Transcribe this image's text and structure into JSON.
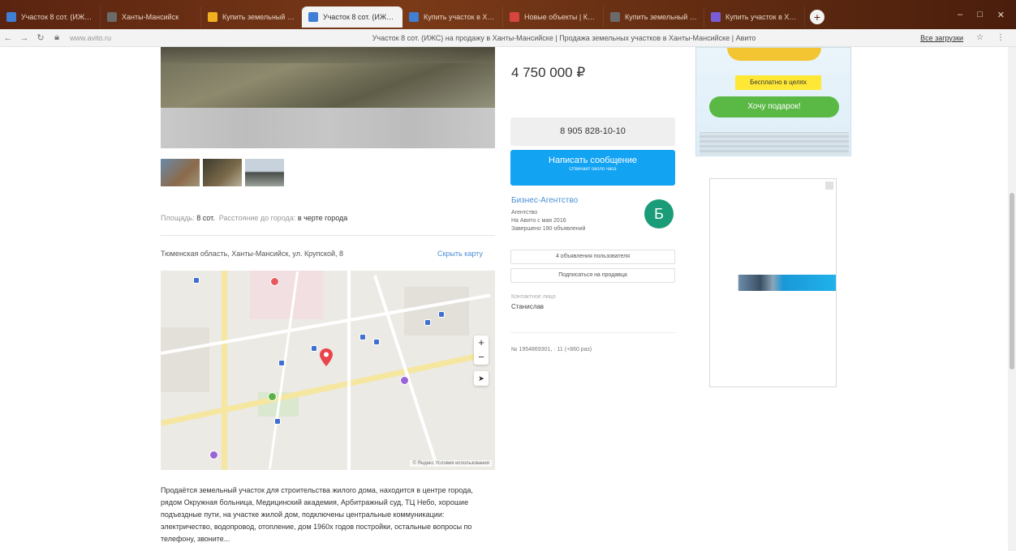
{
  "browser": {
    "tabs": [
      {
        "label": "Участок 8 сот. (ИЖС) по...",
        "icon": "avito-icon",
        "color": "#3f7fd6"
      },
      {
        "label": "Ханты-Мансийск",
        "icon": "page-icon",
        "color": "#6b6b6b"
      },
      {
        "label": "Купить земельный участок",
        "icon": "search-icon",
        "color": "#f2b01e"
      },
      {
        "label": "Участок 8 сот. (ИЖС) — Х",
        "icon": "avito-icon",
        "color": "#3f7fd6",
        "active": true
      },
      {
        "label": "Купить участок в Ханты",
        "icon": "avito-icon",
        "color": "#3f7fd6"
      },
      {
        "label": "Новые объекты | Купить",
        "icon": "yandex-icon",
        "color": "#d6463f"
      },
      {
        "label": "Купить земельный участ",
        "icon": "page-icon",
        "color": "#6b6b6b"
      },
      {
        "label": "Купить участок в Ханты",
        "icon": "page-icon",
        "color": "#7a5cd6"
      }
    ],
    "url_short": "www.avito.ru",
    "page_title": "Участок 8 сот. (ИЖС) на продажу в Ханты-Мансийске | Продажа земельных участков в Ханты-Мансийске | Авито",
    "download_label": "Все загрузки"
  },
  "listing": {
    "area_label": "Площадь:",
    "area_value": "8 сот.",
    "distance_label": "Расстояние до города:",
    "distance_value": "в черте города",
    "address": "Тюменская область, Ханты-Мансийск, ул. Крупской, 8",
    "map_link": "Скрыть карту",
    "map_attribution": "© Яндекс Условия использования",
    "description": "Продаётся земельный участок для строительства жилого дома, находится в центре города, рядом Окружная больница, Медицинский академия, Арбитражный суд, ТЦ Небо, хорошие подъездные пути, на участке жилой дом, подключены центральные коммуникации: электричество, водопровод, отопление, дом 1960х годов постройки, остальные вопросы по телефону, звоните..."
  },
  "sidebar": {
    "price": "4 750 000 ₽",
    "phone": "8 905 828-10-10",
    "message_label": "Написать сообщение",
    "message_sub": "Отвечает около часа",
    "seller_name": "Бизнес-Агентство",
    "seller_type": "Агентство",
    "seller_since": "На Авито с мая 2016",
    "seller_count": "Завершено 190 объявлений",
    "seller_initial": "Б",
    "all_ads_label": "4 объявления пользователя",
    "subscribe_label": "Подписаться на продавца",
    "contact_label": "Контактное лицо",
    "contact_name": "Станислав",
    "ad_number": "№ 1954869301, · 11 (+860 раз)"
  },
  "ads": {
    "banner_tag": "Бесплатно в целях",
    "banner_button": "Хочу подарок!"
  },
  "colors": {
    "accent": "#13a3f3",
    "seller_avatar": "#1b9c78",
    "link": "#4a8fd6"
  }
}
